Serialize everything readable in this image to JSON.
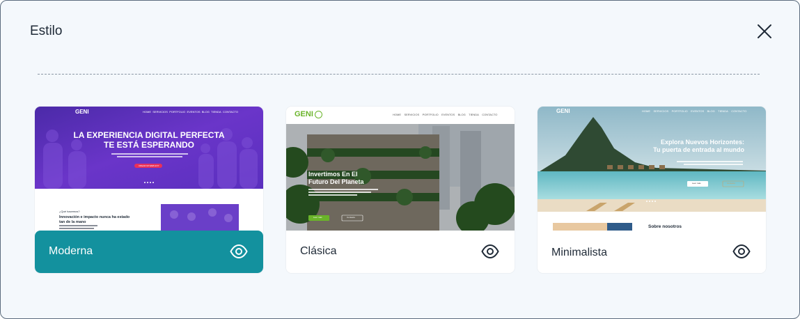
{
  "dialog": {
    "title": "Estilo",
    "close_icon": "close-icon"
  },
  "colors": {
    "accent": "#13919e",
    "moderna_purple": "#5a2fbe",
    "clasica_green": "#6ab42a"
  },
  "styles": [
    {
      "label": "Moderna",
      "selected": true,
      "preview": {
        "brand": "GENI",
        "nav": [
          "HOME",
          "SERVICIOS",
          "PORTFOLIO",
          "EVENTOS",
          "BLOG",
          "TIENDA",
          "CONTACTO"
        ],
        "hero_line1": "LA EXPERIENCIA DIGITAL PERFECTA",
        "hero_line2": "TE ESTÁ ESPERANDO",
        "cta": "CREAR MI WEB HOY",
        "section_kicker": "¿Qué hacemos?",
        "section_title_1": "Innovación e impacto nunca ha estado",
        "section_title_2": "tan de la mano"
      }
    },
    {
      "label": "Clásica",
      "selected": false,
      "preview": {
        "brand": "GENI",
        "nav": [
          "HOME",
          "SERVICIOS",
          "PORTFOLIO",
          "EVENTOS",
          "BLOG",
          "TIENDA",
          "CONTACTO"
        ],
        "hero_line1": "Invertimos En El",
        "hero_line2": "Futuro Del Planeta",
        "btn1": "Leer más",
        "btn2": "Contacto"
      }
    },
    {
      "label": "Minimalista",
      "selected": false,
      "preview": {
        "brand": "GENI",
        "nav": [
          "HOME",
          "SERVICIOS",
          "PORTFOLIO",
          "EVENTOS",
          "BLOG",
          "TIENDA",
          "CONTACTO"
        ],
        "hero_line1": "Explora Nuevos Horizontes:",
        "hero_line2": "Tu puerta de entrada al mundo",
        "btn1": "Leer más",
        "btn2": "Contacto",
        "section_title": "Sobre nosotros"
      }
    }
  ],
  "icons": {
    "preview": "eye-icon"
  }
}
